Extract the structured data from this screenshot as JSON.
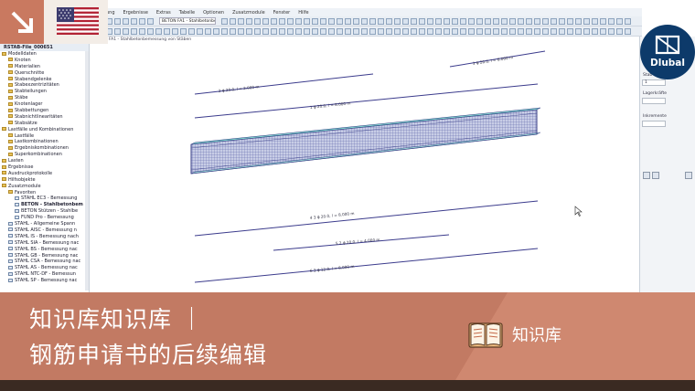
{
  "app": {
    "nav_title": "RSTAB-File_000651",
    "view_title": "FA1 - Stahlbetonbemessung von Stäben",
    "module_select": "BETON FA1 - Stahlbetonbe"
  },
  "menu": [
    "ung",
    "Ergebnisse",
    "Extras",
    "Tabelle",
    "Optionen",
    "Zusatzmodule",
    "Fenster",
    "Hilfe"
  ],
  "nav_items": [
    {
      "label": "Modelldaten",
      "level": 1,
      "icon": "folder-icon"
    },
    {
      "label": "Knoten",
      "level": 2,
      "icon": "folder-icon"
    },
    {
      "label": "Materialien",
      "level": 2,
      "icon": "folder-icon"
    },
    {
      "label": "Querschnitte",
      "level": 2,
      "icon": "folder-icon"
    },
    {
      "label": "Stabendgelenke",
      "level": 2,
      "icon": "folder-icon"
    },
    {
      "label": "Stabexzentrizitäten",
      "level": 2,
      "icon": "folder-icon"
    },
    {
      "label": "Stabteilungen",
      "level": 2,
      "icon": "folder-icon"
    },
    {
      "label": "Stäbe",
      "level": 2,
      "icon": "folder-icon"
    },
    {
      "label": "Knotenlager",
      "level": 2,
      "icon": "folder-icon"
    },
    {
      "label": "Stabbettungen",
      "level": 2,
      "icon": "folder-icon"
    },
    {
      "label": "Stabnichtlinearitäten",
      "level": 2,
      "icon": "folder-icon"
    },
    {
      "label": "Stabsätze",
      "level": 2,
      "icon": "folder-icon"
    },
    {
      "label": "Lastfälle und Kombinationen",
      "level": 1,
      "icon": "folder-icon"
    },
    {
      "label": "Lastfälle",
      "level": 2,
      "icon": "folder-icon"
    },
    {
      "label": "Lastkombinationen",
      "level": 2,
      "icon": "folder-icon"
    },
    {
      "label": "Ergebniskombinationen",
      "level": 2,
      "icon": "folder-icon"
    },
    {
      "label": "Superkombinationen",
      "level": 2,
      "icon": "folder-icon"
    },
    {
      "label": "Lasten",
      "level": 1,
      "icon": "folder-icon"
    },
    {
      "label": "Ergebnisse",
      "level": 1,
      "icon": "folder-icon"
    },
    {
      "label": "Ausdruckprotokolle",
      "level": 1,
      "icon": "folder-icon"
    },
    {
      "label": "Hilfsobjekte",
      "level": 1,
      "icon": "folder-icon"
    },
    {
      "label": "Zusatzmodule",
      "level": 1,
      "icon": "folder-icon"
    },
    {
      "label": "Favoriten",
      "level": 2,
      "icon": "folder-icon"
    },
    {
      "label": "STAHL EC3 - Bemessung",
      "level": 3,
      "icon": "doc-icon"
    },
    {
      "label": "BETON - Stahlbetonbem",
      "level": 3,
      "icon": "doc-icon",
      "bold": true
    },
    {
      "label": "BETON Stützen - Stahlbe",
      "level": 3,
      "icon": "doc-icon"
    },
    {
      "label": "FUND Pro - Bemessung",
      "level": 3,
      "icon": "doc-icon"
    },
    {
      "label": "STAHL - Allgemeine Spann",
      "level": 2,
      "icon": "doc-icon"
    },
    {
      "label": "STAHL AISC - Bemessung n",
      "level": 2,
      "icon": "doc-icon"
    },
    {
      "label": "STAHL IS - Bemessung nach",
      "level": 2,
      "icon": "doc-icon"
    },
    {
      "label": "STAHL SIA - Bemessung nac",
      "level": 2,
      "icon": "doc-icon"
    },
    {
      "label": "STAHL BS - Bemessung nac",
      "level": 2,
      "icon": "doc-icon"
    },
    {
      "label": "STAHL GB - Bemessung nac",
      "level": 2,
      "icon": "doc-icon"
    },
    {
      "label": "STAHL CSA - Bemessung nac",
      "level": 2,
      "icon": "doc-icon"
    },
    {
      "label": "STAHL AS - Bemessung nac",
      "level": 2,
      "icon": "doc-icon"
    },
    {
      "label": "STAHL NTC-DF - Bemessun",
      "level": 2,
      "icon": "doc-icon"
    },
    {
      "label": "STAHL SP - Bemessung nac",
      "level": 2,
      "icon": "doc-icon"
    }
  ],
  "rebar_labels": [
    "3 ϕ 20.0, l = 8.000 m",
    "2 ϕ 20.0, l = 2.000 m",
    "1 ϕ 20.0, l = 8.000 m",
    "4 3 ϕ 20.0, l = 8.000 m",
    "5 2 ϕ 20.0, l = 4.000 m",
    "6 3 ϕ 12.0, l = 8.000 m"
  ],
  "right_panel": {
    "label1": "Stab",
    "value1": "1",
    "label2": "Lagerkräfte",
    "label3": "Inkremente"
  },
  "brand": {
    "name": "Dlubal"
  },
  "banner": {
    "line1": "知识库知识库 ｜",
    "line2": "钢筋申请书的后续编辑",
    "tag": "知识库"
  },
  "colors": {
    "accent": "#c0715a",
    "brand": "#0d3a6a",
    "rebar": "#3b3b8c"
  }
}
